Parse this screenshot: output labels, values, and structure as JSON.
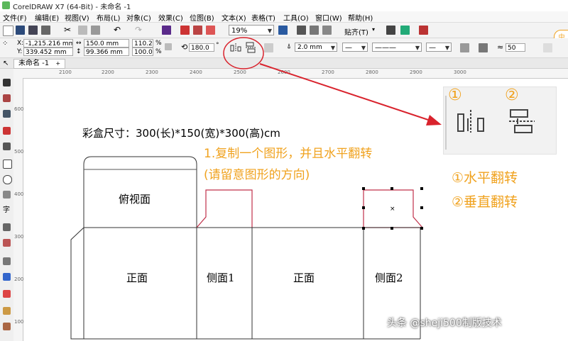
{
  "window": {
    "title": "CorelDRAW X7 (64-Bit) - 未命名 -1"
  },
  "menu": [
    "文件(F)",
    "编辑(E)",
    "视图(V)",
    "布局(L)",
    "对象(C)",
    "效果(C)",
    "位图(B)",
    "文本(X)",
    "表格(T)",
    "工具(O)",
    "窗口(W)",
    "帮助(H)"
  ],
  "toolbar": {
    "zoom_value": "19%",
    "snap_label": "贴齐(T)"
  },
  "propbar": {
    "x_label": "X:",
    "x_value": "-1,215.216 mm",
    "y_label": "Y:",
    "y_value": "339.452 mm",
    "w_value": "150.0 mm",
    "h_value": "99.366 mm",
    "sx_value": "110.2",
    "sy_value": "100.0",
    "pct": "%",
    "angle_value": "180.0",
    "outline_value": "2.0 mm",
    "nudge_value": "50"
  },
  "tab": {
    "label": "未命名 -1"
  },
  "ruler": {
    "h_ticks": [
      "2100",
      "2200",
      "2300",
      "2400",
      "2500",
      "2600",
      "2700",
      "2800",
      "2900",
      "3000"
    ],
    "v_ticks": [
      "600",
      "500",
      "400",
      "300",
      "200",
      "100"
    ]
  },
  "canvas": {
    "heading": "彩盒尺寸：300(长)*150(宽)*300(高)cm",
    "instruction_line1": "1.复制一个图形，并且水平翻转",
    "instruction_line2": "(请留意图形的方向)",
    "top_face": "俯视面",
    "front_face_1": "正面",
    "side_face_1": "侧面1",
    "front_face_2": "正面",
    "side_face_2": "侧面2"
  },
  "zoom_panel": {
    "num1": "①",
    "num2": "②",
    "legend1": "①水平翻转",
    "legend2": "②垂直翻转"
  },
  "watermark": "头条 @sheji500制版技术",
  "dock_label": "中"
}
